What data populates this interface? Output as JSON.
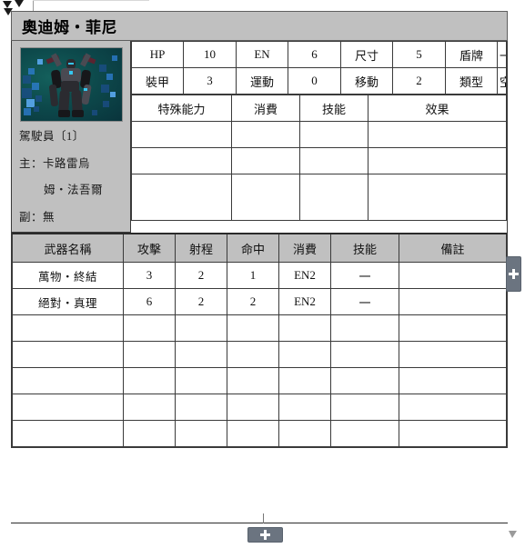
{
  "card": {
    "title": "奧迪姆・菲尼"
  },
  "portrait": {
    "alt_name": "mech-portrait"
  },
  "pilot": {
    "header": "駕駛員〔1〕",
    "main_label_line": "主：卡路雷烏",
    "main_name_line2": "姆・法吾爾",
    "sub_label_line": "副：無"
  },
  "stats": {
    "row1": [
      {
        "label": "HP",
        "value": "10"
      },
      {
        "label": "EN",
        "value": "6"
      },
      {
        "label": "尺寸",
        "value": "5"
      },
      {
        "label": "盾牌",
        "value": "一"
      }
    ],
    "row2": [
      {
        "label": "裝甲",
        "value": "3"
      },
      {
        "label": "運動",
        "value": "0"
      },
      {
        "label": "移動",
        "value": "2"
      },
      {
        "label": "類型",
        "value": "空陸"
      }
    ]
  },
  "abilities": {
    "headers": [
      "特殊能力",
      "消費",
      "技能",
      "效果"
    ],
    "rows": [
      {
        "name": "",
        "cost": "",
        "skill": "",
        "effect": ""
      },
      {
        "name": "",
        "cost": "",
        "skill": "",
        "effect": ""
      },
      {
        "name": "",
        "cost": "",
        "skill": "",
        "effect": ""
      }
    ]
  },
  "weapons": {
    "headers": [
      "武器名稱",
      "攻擊",
      "射程",
      "命中",
      "消費",
      "技能",
      "備註"
    ],
    "rows": [
      {
        "name": "萬物・終結",
        "atk": "3",
        "range": "2",
        "hit": "1",
        "cost": "EN2",
        "skill": "一",
        "note": ""
      },
      {
        "name": "絕對・真理",
        "atk": "6",
        "range": "2",
        "hit": "2",
        "cost": "EN2",
        "skill": "一",
        "note": ""
      },
      {
        "name": "",
        "atk": "",
        "range": "",
        "hit": "",
        "cost": "",
        "skill": "",
        "note": ""
      },
      {
        "name": "",
        "atk": "",
        "range": "",
        "hit": "",
        "cost": "",
        "skill": "",
        "note": ""
      },
      {
        "name": "",
        "atk": "",
        "range": "",
        "hit": "",
        "cost": "",
        "skill": "",
        "note": ""
      },
      {
        "name": "",
        "atk": "",
        "range": "",
        "hit": "",
        "cost": "",
        "skill": "",
        "note": ""
      },
      {
        "name": "",
        "atk": "",
        "range": "",
        "hit": "",
        "cost": "",
        "skill": "",
        "note": ""
      }
    ]
  },
  "controls": {
    "add_column_label": "+",
    "add_row_label": "+"
  },
  "colors": {
    "header_gray": "#c0c0c0",
    "border_dark": "#3a3a3a",
    "handle": "#6b7480",
    "page_bg": "#ffffff"
  }
}
